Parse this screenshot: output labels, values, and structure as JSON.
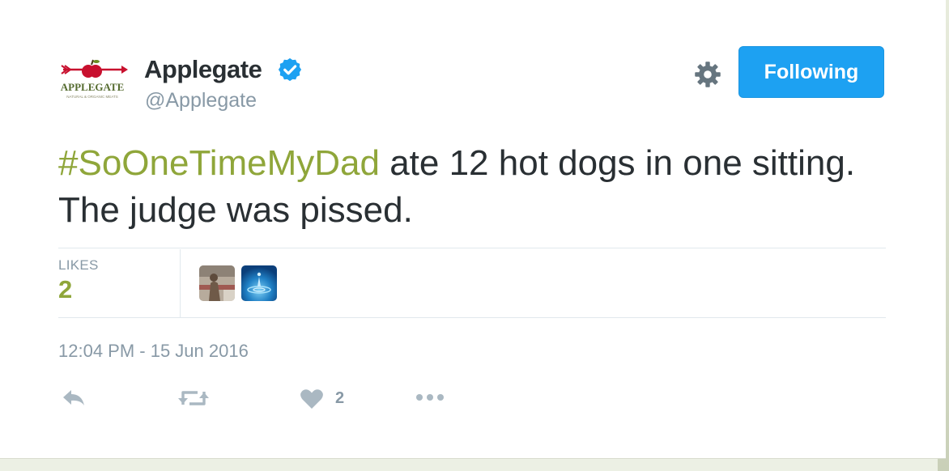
{
  "profile": {
    "name": "Applegate",
    "handle": "@Applegate",
    "logo_text": "APPLEGATE",
    "logo_subtext": "NATURAL & ORGANIC MEATS"
  },
  "header": {
    "follow_label": "Following"
  },
  "tweet": {
    "hashtag": "#SoOneTimeMyDad",
    "text": " ate 12 hot dogs in one sitting. The judge was pissed."
  },
  "stats": {
    "likes_label": "LIKES",
    "likes_count": "2"
  },
  "timestamp": "12:04 PM - 15 Jun 2016",
  "actions": {
    "like_count": "2"
  },
  "colors": {
    "link_accent": "#8fa63a",
    "follow_button": "#1da1f2",
    "muted_text": "#8899a6",
    "body_text": "#292f33"
  }
}
